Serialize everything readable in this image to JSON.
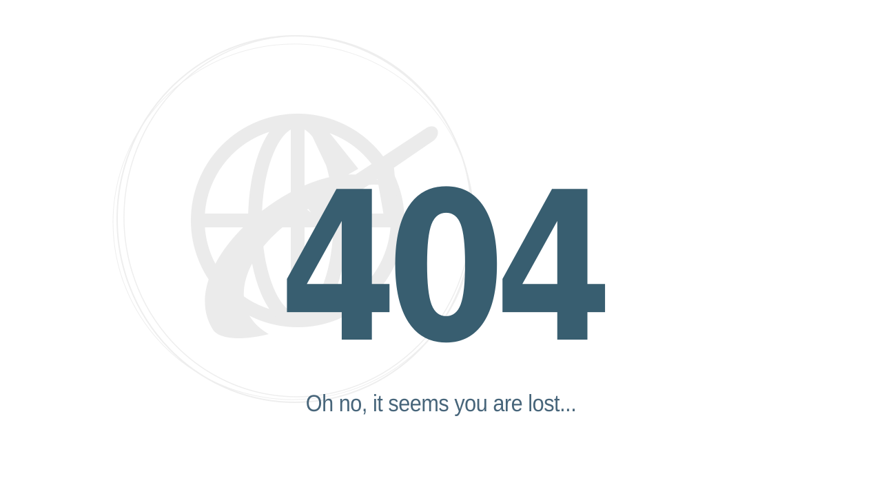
{
  "error": {
    "code": "404",
    "message": "Oh no, it seems you are lost..."
  },
  "illustration": {
    "icon": "globe-airplane-icon",
    "color": "#ebebeb"
  },
  "colors": {
    "accent": "#385e70",
    "background": "#ffffff"
  }
}
